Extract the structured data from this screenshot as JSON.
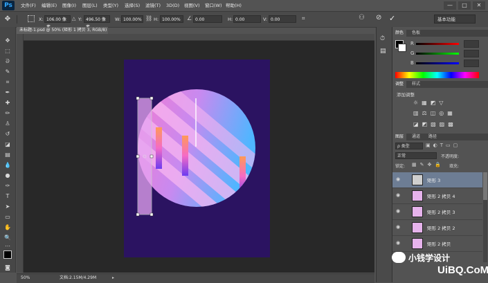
{
  "app": {
    "logo": "Ps"
  },
  "menu": [
    "文件(F)",
    "编辑(E)",
    "图像(I)",
    "图层(L)",
    "类型(Y)",
    "选择(S)",
    "滤镜(T)",
    "3D(D)",
    "视图(V)",
    "窗口(W)",
    "帮助(H)"
  ],
  "window_buttons": [
    "—",
    "□",
    "✕"
  ],
  "options": {
    "x_label": "X:",
    "x_value": "106.00 像素",
    "y_label": "Y:",
    "y_value": "496.50 像素",
    "w_label": "W:",
    "w_value": "100.00%",
    "h_label": "H:",
    "h_value": "100.00%",
    "angle_value": "0.00",
    "hskew_label": "H:",
    "hskew_value": "0.00",
    "vskew_label": "V:",
    "vskew_value": "0.00",
    "workspace": "基本功能"
  },
  "document": {
    "tab_title": "未标题-1.psd @ 50% (矩形 1 拷贝 3, RGB/8) *",
    "zoom": "50%",
    "doc_size": "文档:2.15M/4.29M"
  },
  "colors": {
    "artboard": "#2b1361",
    "foreground": "#000000",
    "background": "#ffffff"
  },
  "color_panel": {
    "tabs": [
      "颜色",
      "色板"
    ],
    "channels": [
      {
        "label": "R",
        "value": ""
      },
      {
        "label": "G",
        "value": ""
      },
      {
        "label": "B",
        "value": ""
      }
    ]
  },
  "adjust_panel": {
    "tabs": [
      "调整",
      "样式"
    ],
    "title": "添加调整"
  },
  "layers_panel": {
    "tabs": [
      "图层",
      "通道",
      "路径"
    ],
    "kind_filter": "ρ 类型",
    "blend_mode": "正常",
    "opacity_label": "不透明度:",
    "lock_label": "锁定:",
    "fill_label": "填充:",
    "layers": [
      {
        "name": "矩形 3",
        "selected": true
      },
      {
        "name": "矩形 2 拷贝 4",
        "selected": false
      },
      {
        "name": "矩形 2 拷贝 3",
        "selected": false
      },
      {
        "name": "矩形 2 拷贝 2",
        "selected": false
      },
      {
        "name": "矩形 2 拷贝",
        "selected": false
      }
    ]
  },
  "watermark": {
    "wechat": "小钱学设计",
    "site": "UiBQ.CoM"
  }
}
